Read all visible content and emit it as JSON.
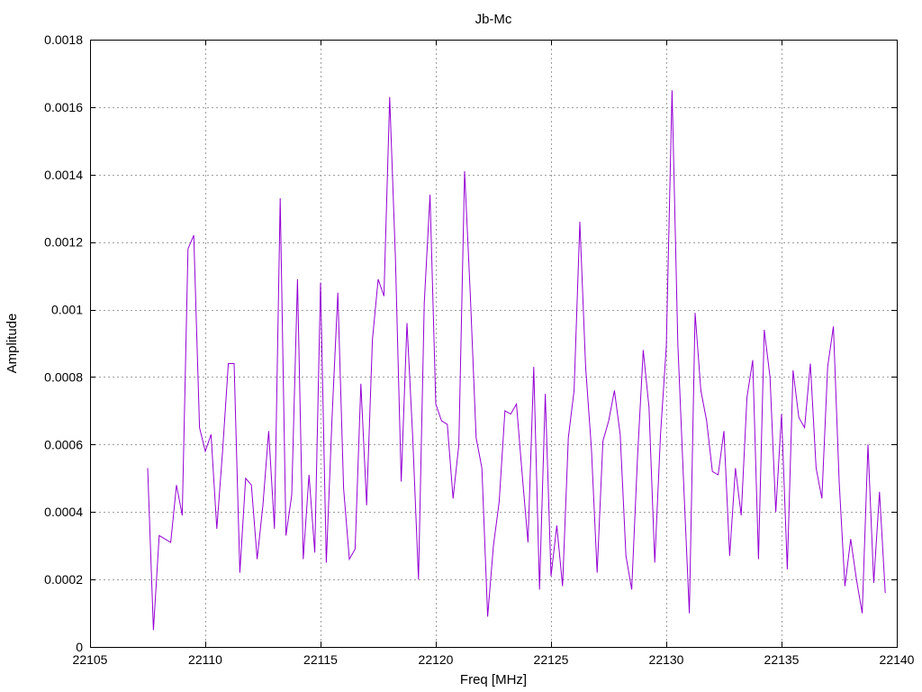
{
  "chart_data": {
    "type": "line",
    "title": "Jb-Mc",
    "xlabel": "Freq [MHz]",
    "ylabel": "Amplitude",
    "xlim": [
      22105,
      22140
    ],
    "ylim": [
      0,
      0.0018
    ],
    "xticks": [
      22105,
      22110,
      22115,
      22120,
      22125,
      22130,
      22135,
      22140
    ],
    "xtick_labels": [
      "22105",
      "22110",
      "22115",
      "22120",
      "22125",
      "22130",
      "22135",
      "22140"
    ],
    "yticks": [
      0,
      0.0002,
      0.0004,
      0.0006,
      0.0008,
      0.001,
      0.0012,
      0.0014,
      0.0016,
      0.0018
    ],
    "ytick_labels": [
      "0",
      "0.0002",
      "0.0004",
      "0.0006",
      "0.0008",
      "0.001",
      "0.0012",
      "0.0014",
      "0.0016",
      "0.0018"
    ],
    "grid": true,
    "legend": "none",
    "series": [
      {
        "color": "#9400d3",
        "x": [
          22107.5,
          22107.75,
          22108.0,
          22108.25,
          22108.5,
          22108.75,
          22109.0,
          22109.25,
          22109.5,
          22109.75,
          22110.0,
          22110.25,
          22110.5,
          22110.75,
          22111.0,
          22111.25,
          22111.5,
          22111.75,
          22112.0,
          22112.25,
          22112.5,
          22112.75,
          22113.0,
          22113.25,
          22113.5,
          22113.75,
          22114.0,
          22114.25,
          22114.5,
          22114.75,
          22115.0,
          22115.25,
          22115.5,
          22115.75,
          22116.0,
          22116.25,
          22116.5,
          22116.75,
          22117.0,
          22117.25,
          22117.5,
          22117.75,
          22118.0,
          22118.25,
          22118.5,
          22118.75,
          22119.0,
          22119.25,
          22119.5,
          22119.75,
          22120.0,
          22120.25,
          22120.5,
          22120.75,
          22121.0,
          22121.25,
          22121.5,
          22121.75,
          22122.0,
          22122.25,
          22122.5,
          22122.75,
          22123.0,
          22123.25,
          22123.5,
          22123.75,
          22124.0,
          22124.25,
          22124.5,
          22124.75,
          22125.0,
          22125.25,
          22125.5,
          22125.75,
          22126.0,
          22126.25,
          22126.5,
          22126.75,
          22127.0,
          22127.25,
          22127.5,
          22127.75,
          22128.0,
          22128.25,
          22128.5,
          22128.75,
          22129.0,
          22129.25,
          22129.5,
          22129.75,
          22130.0,
          22130.25,
          22130.5,
          22130.75,
          22131.0,
          22131.25,
          22131.5,
          22131.75,
          22132.0,
          22132.25,
          22132.5,
          22132.75,
          22133.0,
          22133.25,
          22133.5,
          22133.75,
          22134.0,
          22134.25,
          22134.5,
          22134.75,
          22135.0,
          22135.25,
          22135.5,
          22135.75,
          22136.0,
          22136.25,
          22136.5,
          22136.75,
          22137.0,
          22137.25,
          22137.5,
          22137.75,
          22138.0,
          22138.25,
          22138.5,
          22138.75,
          22139.0,
          22139.25,
          22139.5
        ],
        "y": [
          0.00053,
          5e-05,
          0.00033,
          0.00032,
          0.00031,
          0.00048,
          0.00039,
          0.00118,
          0.00122,
          0.00065,
          0.00058,
          0.00063,
          0.00035,
          0.00058,
          0.00084,
          0.00084,
          0.00022,
          0.0005,
          0.00048,
          0.00026,
          0.00042,
          0.00064,
          0.00035,
          0.00133,
          0.00033,
          0.00045,
          0.00109,
          0.00026,
          0.00051,
          0.00028,
          0.00108,
          0.00025,
          0.00068,
          0.00105,
          0.00047,
          0.00026,
          0.00029,
          0.00078,
          0.00042,
          0.00091,
          0.00109,
          0.00104,
          0.00163,
          0.00115,
          0.00049,
          0.00096,
          0.00062,
          0.0002,
          0.00102,
          0.00134,
          0.00072,
          0.00067,
          0.00066,
          0.00044,
          0.0006,
          0.00141,
          0.00104,
          0.00062,
          0.00053,
          9e-05,
          0.0003,
          0.00043,
          0.0007,
          0.00069,
          0.00072,
          0.00051,
          0.00031,
          0.00083,
          0.00017,
          0.00075,
          0.00021,
          0.00036,
          0.00018,
          0.00062,
          0.00076,
          0.00126,
          0.00083,
          0.00059,
          0.00022,
          0.00061,
          0.00067,
          0.00076,
          0.00063,
          0.00027,
          0.00017,
          0.00056,
          0.00088,
          0.00071,
          0.00025,
          0.00063,
          0.00089,
          0.00165,
          0.0009,
          0.00049,
          0.0001,
          0.00099,
          0.00076,
          0.00067,
          0.00052,
          0.00051,
          0.00064,
          0.00027,
          0.00053,
          0.00039,
          0.00074,
          0.00085,
          0.00026,
          0.00094,
          0.0008,
          0.0004,
          0.00069,
          0.00023,
          0.00082,
          0.00068,
          0.00065,
          0.00084,
          0.00053,
          0.00044,
          0.00083,
          0.00095,
          0.00049,
          0.00018,
          0.00032,
          0.0002,
          0.0001,
          0.0006,
          0.00019,
          0.00046,
          0.00016
        ]
      }
    ]
  }
}
